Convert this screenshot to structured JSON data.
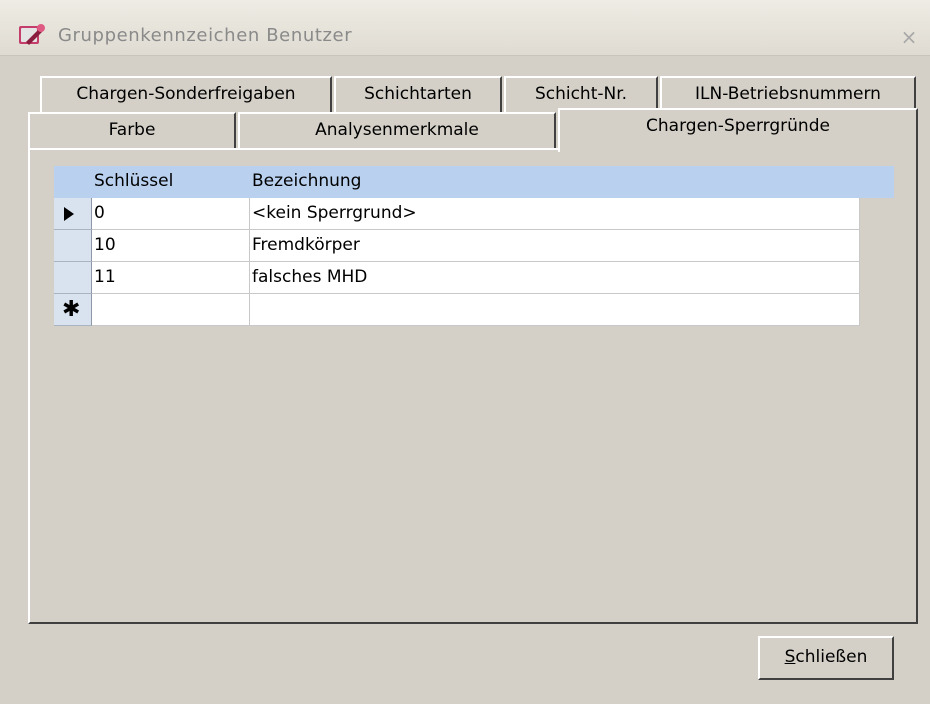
{
  "window": {
    "title": "Gruppenkennzeichen Benutzer",
    "icon": "wrench-key-icon",
    "close_symbol": "×"
  },
  "tabs_row1": [
    {
      "label": "Chargen-Sonderfreigaben"
    },
    {
      "label": "Schichtarten"
    },
    {
      "label": "Schicht-Nr."
    },
    {
      "label": "ILN-Betriebsnummern"
    }
  ],
  "tabs_row2": [
    {
      "label": "Farbe"
    },
    {
      "label": "Analysenmerkmale"
    },
    {
      "label": "Chargen-Sperrgründe",
      "selected": true
    }
  ],
  "grid": {
    "columns": [
      "Schlüssel",
      "Bezeichnung"
    ],
    "rows": [
      {
        "key": "0",
        "name": "<kein Sperrgrund>",
        "current": true
      },
      {
        "key": "10",
        "name": "Fremdkörper"
      },
      {
        "key": "11",
        "name": "falsches MHD"
      }
    ],
    "new_row_symbol": "✱"
  },
  "buttons": {
    "close_accel": "S",
    "close_rest": "chließen"
  },
  "colors": {
    "header_bg": "#b9d1ef",
    "face": "#d4d0c8"
  }
}
